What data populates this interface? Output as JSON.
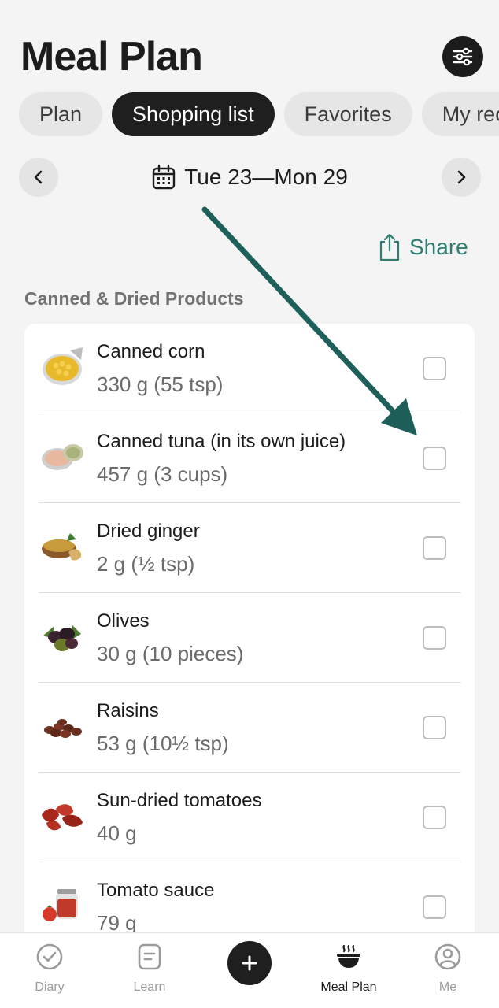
{
  "header": {
    "title": "Meal Plan"
  },
  "tabs": [
    {
      "label": "Plan"
    },
    {
      "label": "Shopping list",
      "active": true
    },
    {
      "label": "Favorites"
    },
    {
      "label": "My recipes"
    }
  ],
  "date_range": {
    "label": "Tue 23—Mon 29"
  },
  "share": {
    "label": "Share"
  },
  "section": {
    "title": "Canned & Dried Products",
    "items": [
      {
        "name": "Canned corn",
        "qty": "330 g (55 tsp)",
        "icon": "canned-corn",
        "checked": false
      },
      {
        "name": "Canned tuna (in its own juice)",
        "qty": "457 g (3 cups)",
        "icon": "canned-tuna",
        "checked": false
      },
      {
        "name": "Dried ginger",
        "qty": "2 g (½ tsp)",
        "icon": "dried-ginger",
        "checked": false
      },
      {
        "name": "Olives",
        "qty": "30 g (10 pieces)",
        "icon": "olives",
        "checked": false
      },
      {
        "name": "Raisins",
        "qty": "53 g (10½ tsp)",
        "icon": "raisins",
        "checked": false
      },
      {
        "name": "Sun-dried tomatoes",
        "qty": "40 g",
        "icon": "sun-dried-tomatoes",
        "checked": false
      },
      {
        "name": "Tomato sauce",
        "qty": "79 g",
        "icon": "tomato-sauce",
        "checked": false
      }
    ]
  },
  "bottom_nav": [
    {
      "label": "Diary",
      "icon": "check-circle-icon"
    },
    {
      "label": "Learn",
      "icon": "note-icon"
    },
    {
      "label": "",
      "icon": "plus-icon"
    },
    {
      "label": "Meal Plan",
      "icon": "bowl-icon",
      "active": true
    },
    {
      "label": "Me",
      "icon": "user-icon"
    }
  ],
  "colors": {
    "accent": "#2f7d73",
    "arrow": "#1f5f5a",
    "background": "#f4f4f4",
    "active_tab": "#1f1f1f"
  }
}
